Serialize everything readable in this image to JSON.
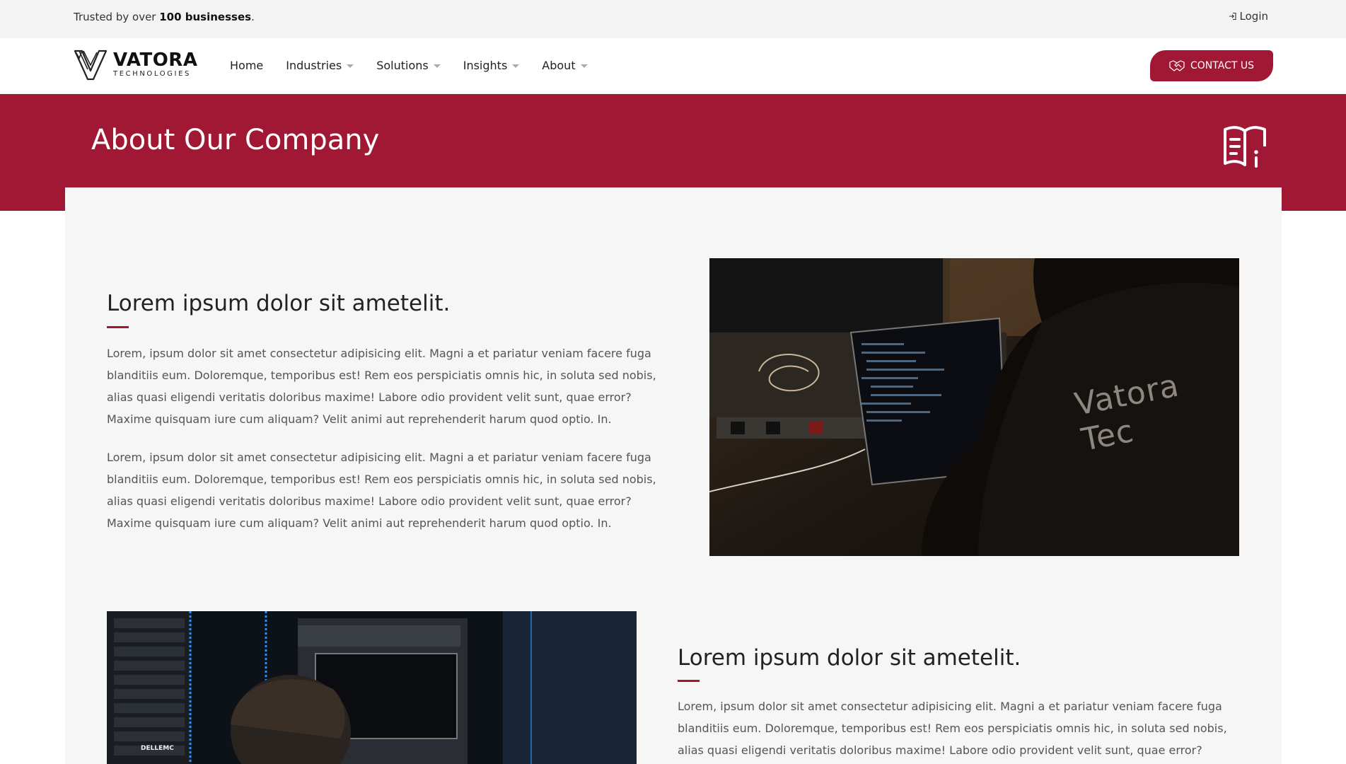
{
  "topbar": {
    "trust_prefix": "Trusted by over ",
    "trust_bold": "100 businesses",
    "trust_suffix": ".",
    "login_label": "Login"
  },
  "logo": {
    "name": "VATORA",
    "sub": "TECHNOLOGIES"
  },
  "nav": {
    "items": [
      {
        "label": "Home",
        "has_dropdown": false
      },
      {
        "label": "Industries",
        "has_dropdown": true
      },
      {
        "label": "Solutions",
        "has_dropdown": true
      },
      {
        "label": "Insights",
        "has_dropdown": true
      },
      {
        "label": "About",
        "has_dropdown": true
      }
    ],
    "contact_label": "CONTACT US"
  },
  "banner": {
    "title": "About Our Company",
    "icon": "book-info-icon"
  },
  "sections": [
    {
      "title": "Lorem ipsum dolor sit ametelit.",
      "paragraphs": [
        "Lorem, ipsum dolor sit amet consectetur adipisicing elit. Magni a et pariatur veniam facere fuga blanditiis eum. Doloremque, temporibus est! Rem eos perspiciatis omnis hic, in soluta sed nobis, alias quasi eligendi veritatis doloribus maxime! Labore odio provident velit sunt, quae error? Maxime quisquam iure cum aliquam? Velit animi aut reprehenderit harum quod optio. In.",
        "Lorem, ipsum dolor sit amet consectetur adipisicing elit. Magni a et pariatur veniam facere fuga blanditiis eum. Doloremque, temporibus est! Rem eos perspiciatis omnis hic, in soluta sed nobis, alias quasi eligendi veritatis doloribus maxime! Labore odio provident velit sunt, quae error? Maxime quisquam iure cum aliquam? Velit animi aut reprehenderit harum quod optio. In."
      ],
      "image_text": "Vatora Tec"
    },
    {
      "title": "Lorem ipsum dolor sit ametelit.",
      "paragraphs": [
        "Lorem, ipsum dolor sit amet consectetur adipisicing elit. Magni a et pariatur veniam facere fuga blanditiis eum. Doloremque, temporibus est! Rem eos perspiciatis omnis hic, in soluta sed nobis, alias quasi eligendi veritatis doloribus maxime! Labore odio provident velit sunt, quae error? Maxime"
      ],
      "image_text": "DELLEMC"
    }
  ],
  "colors": {
    "brand": "#a01834",
    "panel": "#f6f6f6",
    "topbar": "#f3f3f3"
  }
}
